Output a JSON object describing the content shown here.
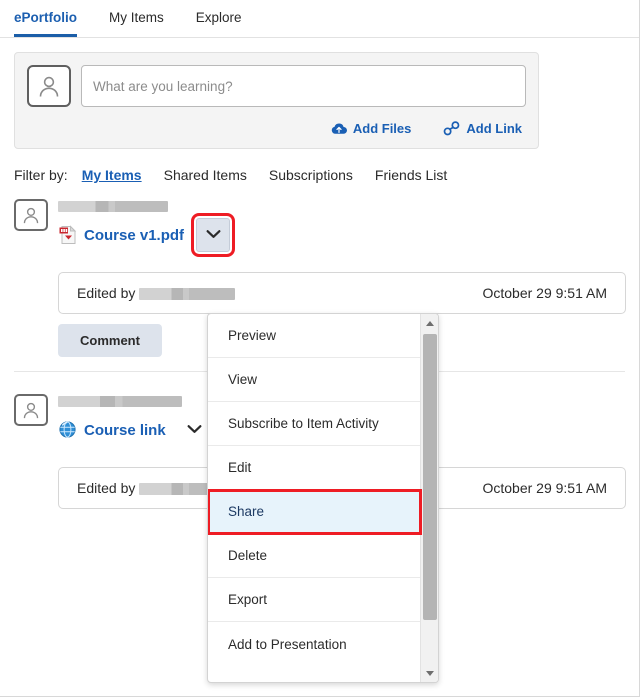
{
  "nav": {
    "tabs": [
      {
        "label": "ePortfolio",
        "active": true
      },
      {
        "label": "My Items",
        "active": false
      },
      {
        "label": "Explore",
        "active": false
      }
    ]
  },
  "composer": {
    "placeholder": "What are you learning?",
    "value": "",
    "avatar_icon": "user-avatar-icon",
    "actions": [
      {
        "label": "Add Files",
        "icon": "cloud-upload-icon"
      },
      {
        "label": "Add Link",
        "icon": "link-chain-icon"
      }
    ]
  },
  "filter": {
    "label": "Filter by:",
    "items": [
      {
        "label": "My Items",
        "active": true
      },
      {
        "label": "Shared Items",
        "active": false
      },
      {
        "label": "Subscriptions",
        "active": false
      },
      {
        "label": "Friends List",
        "active": false
      }
    ]
  },
  "feed": {
    "items": [
      {
        "avatar_icon": "user-avatar-icon",
        "author_redacted": true,
        "file_icon": "pdf-file-icon",
        "title": "Course v1.pdf",
        "chevron_icon": "chevron-down-icon",
        "chevron_highlighted": true,
        "edited_prefix": "Edited by",
        "edited_name_redacted": true,
        "timestamp": "October 29 9:51 AM",
        "comment_label": "Comment"
      },
      {
        "avatar_icon": "user-avatar-icon",
        "author_redacted": true,
        "file_icon": "globe-link-icon",
        "title": "Course link",
        "chevron_icon": "chevron-down-icon",
        "chevron_highlighted": false,
        "edited_prefix": "Edited by",
        "edited_name_redacted": true,
        "timestamp": "October 29 9:51 AM",
        "comment_label": ""
      }
    ]
  },
  "dropdown": {
    "open": true,
    "selected": "Share",
    "items": [
      {
        "label": "Preview",
        "selected": false
      },
      {
        "label": "View",
        "selected": false
      },
      {
        "label": "Subscribe to Item Activity",
        "selected": false
      },
      {
        "label": "Edit",
        "selected": false
      },
      {
        "label": "Share",
        "selected": true
      },
      {
        "label": "Delete",
        "selected": false
      },
      {
        "label": "Export",
        "selected": false
      },
      {
        "label": "Add to Presentation",
        "selected": false
      }
    ],
    "scrollbar": {
      "up_icon": "scroll-up-arrow-icon",
      "down_icon": "scroll-down-arrow-icon"
    }
  },
  "colors": {
    "accent_blue": "#1a5fb4",
    "highlight_red": "#ee1c24",
    "selected_bg": "#e7f3fb",
    "button_bg": "#dde3ec"
  }
}
